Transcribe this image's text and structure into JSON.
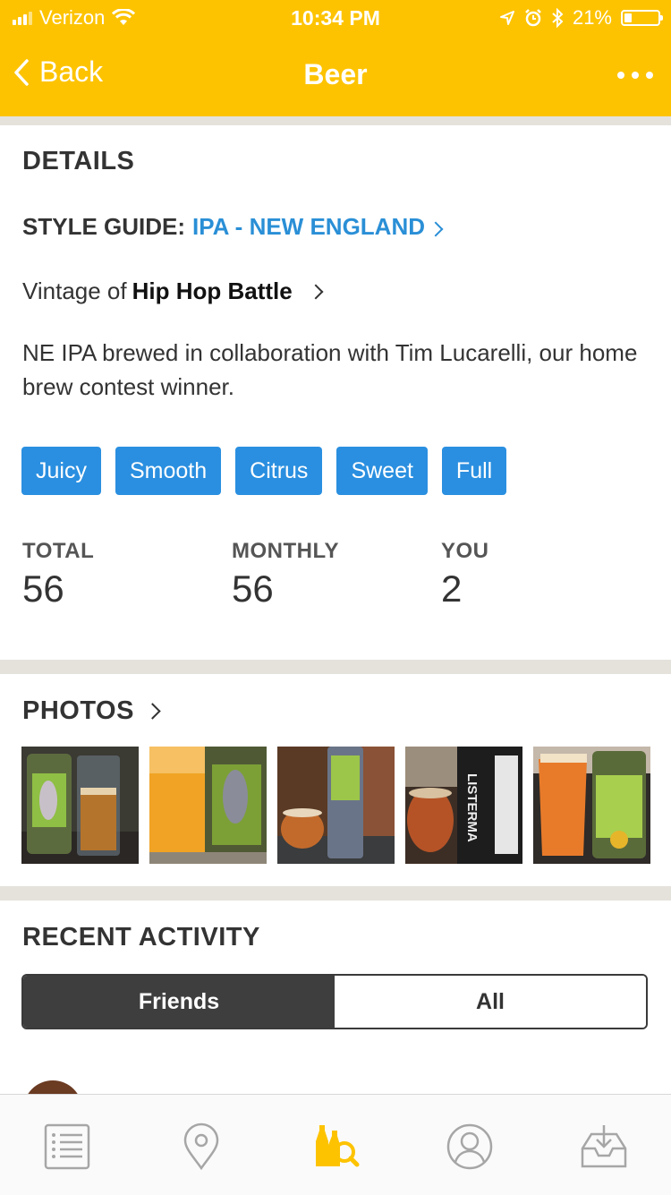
{
  "status": {
    "carrier": "Verizon",
    "time": "10:34 PM",
    "battery": "21%"
  },
  "nav": {
    "back_label": "Back",
    "title": "Beer"
  },
  "details": {
    "heading": "DETAILS",
    "style_label": "STYLE GUIDE:",
    "style_value": "IPA - NEW ENGLAND",
    "vintage_prefix": "Vintage of",
    "vintage_name": "Hip Hop Battle",
    "description": "NE IPA brewed in collaboration with Tim Lucarelli, our home brew contest winner.",
    "tags": [
      "Juicy",
      "Smooth",
      "Citrus",
      "Sweet",
      "Full"
    ],
    "stats": [
      {
        "label": "TOTAL",
        "value": "56"
      },
      {
        "label": "MONTHLY",
        "value": "56"
      },
      {
        "label": "YOU",
        "value": "2"
      }
    ]
  },
  "photos": {
    "heading": "PHOTOS",
    "can_text": "LISTERMA"
  },
  "activity": {
    "heading": "RECENT ACTIVITY",
    "tab_friends": "Friends",
    "tab_all": "All"
  },
  "tabbar": {
    "items": [
      "list-icon",
      "map-pin-icon",
      "beer-search-icon",
      "profile-icon",
      "inbox-download-icon"
    ]
  },
  "colors": {
    "accent": "#fdc300",
    "link": "#2a8fd6",
    "tag": "#2a8fe0",
    "separator": "#e5e2dc"
  }
}
